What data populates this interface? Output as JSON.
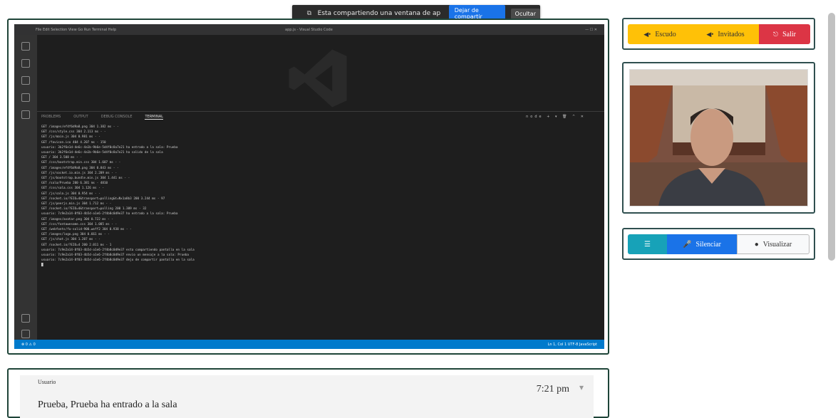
{
  "share_banner": {
    "icon": "screen-share-icon",
    "message": "Esta compartiendo una ventana de aplicación",
    "stop_label": "Dejar de compartir",
    "hide_label": "Ocultar"
  },
  "screen_share": {
    "titlebar_menu": "File  Edit  Selection  View  Go  Run  Terminal  Help",
    "titlebar_title": "app.js - Visual Studio Code",
    "window_controls": "—  ☐  ✕",
    "terminal_tabs": [
      "PROBLEMS",
      "OUTPUT",
      "DEBUG CONSOLE",
      "TERMINAL"
    ],
    "terminal_active_tab": "TERMINAL",
    "terminal_controls": "node  +  ▾  🗑  ^  ✕",
    "terminal_lines": [
      "GET /images/ef4f6d9a8.png 304 1.382 ms - -",
      "GET /css/style.css 304 2.113 ms - -",
      "GET /js/main.js 304 0.981 ms - -",
      "GET /favicon.ico 404 4.207 ms - 150",
      "usuario: 3b2f6e1d-4e6c-4a1b-9b6e-5d4f0c8a7e21 ha entrado a la sala: Prueba",
      "usuario: 3b2f6e1d-4e6c-4a1b-9b6e-5d4f0c8a7e21 ha salido de la sala",
      "GET / 304 3.508 ms - -",
      "GET /css/bootstrap.min.css 304 1.607 ms - -",
      "GET /images/ef4f6d9a8.png 304 0.843 ms - -",
      "GET /js/socket.io.min.js 304 2.209 ms - -",
      "GET /js/bootstrap.bundle.min.js 304 1.441 ms - -",
      "GET /sala/Prueba 200 6.381 ms - 4810",
      "GET /css/sala.css 304 1.126 ms - -",
      "GET /js/sala.js 304 0.954 ms - -",
      "GET /socket.io/?EIO=4&transport=polling&t=Nx1a8b3 200 3.244 ms - 97",
      "GET /js/peerjs.min.js 304 1.712 ms - -",
      "GET /socket.io/?EIO=4&transport=polling 200 1.309 ms - 32",
      "usuario: 7c9e2a14-8f03-4b5d-a1e6-2f4b8c0d9e37 ha entrado a la sala: Prueba",
      "GET /images/avatar.png 304 0.722 ms - -",
      "GET /css/fontawesome.css 304 1.085 ms - -",
      "GET /webfonts/fa-solid-900.woff2 304 0.938 ms - -",
      "GET /images/logo.png 304 0.661 ms - -",
      "GET /js/chat.js 304 1.207 ms - -",
      "GET /socket.io/?EIO=4 200 2.011 ms - 1",
      "usuario: 7c9e2a14-8f03-4b5d-a1e6-2f4b8c0d9e37 esta compartiendo pantalla en la sala",
      "usuario: 7c9e2a14-8f03-4b5d-a1e6-2f4b8c0d9e37 envio un mensaje a la sala: Prueba",
      "usuario: 7c9e2a14-8f03-4b5d-a1e6-2f4b8c0d9e37 dejo de compartir pantalla en la sala",
      "█"
    ],
    "status_left": "⊗ 0  ⚠ 0",
    "status_right": "Ln 1, Col 1   UTF-8   JavaScript"
  },
  "room_controls": {
    "escudo_label": "Escudo",
    "invitados_label": "Invitados",
    "salir_label": "Salir"
  },
  "tools": {
    "mute_label": "Silenciar",
    "toggle_label": "Visualizar"
  },
  "chat": {
    "messages": [
      {
        "user": "Usuario",
        "time": "7:21 pm",
        "text": "Prueba, Prueba ha entrado a la sala"
      }
    ]
  },
  "colors": {
    "panel_border": "#1e4438",
    "warning": "#ffc107",
    "danger": "#dc3545",
    "info": "#17a2b8",
    "primary": "#1a73e8",
    "vscode_status": "#007acc"
  }
}
